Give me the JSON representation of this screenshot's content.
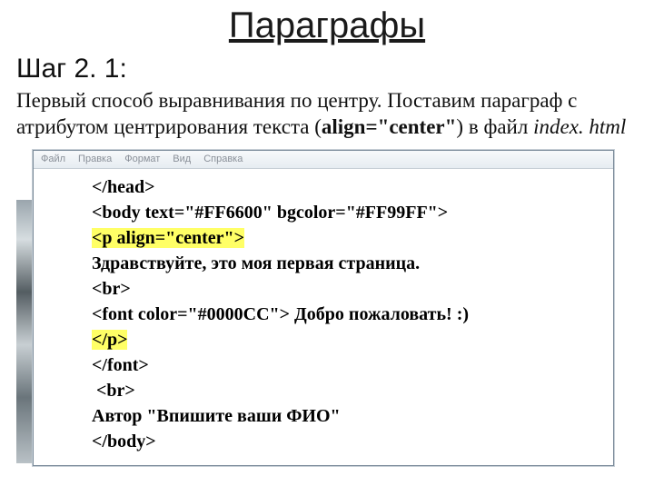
{
  "title": "Параграфы",
  "step_label": "Шаг 2. 1:",
  "description": {
    "part1": "Первый способ выравнивания по центру. Поставим параграф с атрибутом центрирования текста (",
    "bold": "align=\"center\"",
    "part2": ") в файл ",
    "ital": "index. html"
  },
  "menubar": [
    "Файл",
    "Правка",
    "Формат",
    "Вид",
    "Справка"
  ],
  "code": {
    "l1": "</head>",
    "l2": "<body text=\"#FF6600\" bgcolor=\"#FF99FF\">",
    "l3": "<p align=\"center\">",
    "l4": "Здравствуйте, это моя первая страница.",
    "l5": "<br>",
    "l6_a": "<font color=\"#0000CC\"> ",
    "l6_b": "Добро пожаловать! :)",
    "l7": "</p>",
    "l8": "</font>",
    "l9": " <br>",
    "l10": "Автор \"Впишите ваши ФИО\"",
    "l11": "</body>"
  }
}
